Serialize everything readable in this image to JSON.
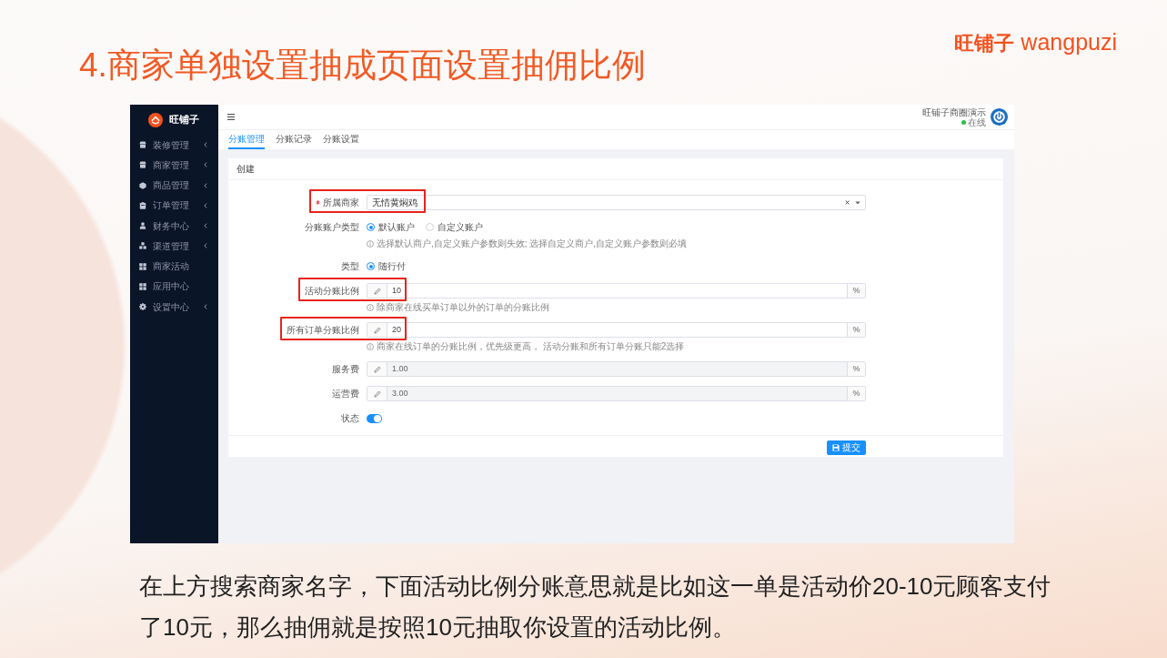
{
  "title": "4.商家单独设置抽成页面设置抽佣比例",
  "logo": {
    "cn": "旺铺子",
    "en": "wangpuzi"
  },
  "sidebar": {
    "brand": "旺铺子",
    "items": [
      {
        "label": "装修管理",
        "expandable": true
      },
      {
        "label": "商家管理",
        "expandable": true
      },
      {
        "label": "商品管理",
        "expandable": true
      },
      {
        "label": "订单管理",
        "expandable": true
      },
      {
        "label": "财务中心",
        "expandable": true
      },
      {
        "label": "渠道管理",
        "expandable": true
      },
      {
        "label": "商家活动",
        "expandable": false
      },
      {
        "label": "应用中心",
        "expandable": false
      },
      {
        "label": "设置中心",
        "expandable": true
      }
    ]
  },
  "topbar": {
    "user": "旺铺子商圈演示",
    "status": "在线",
    "online": true
  },
  "tabs": [
    {
      "label": "分账管理",
      "selected": true
    },
    {
      "label": "分账记录",
      "selected": false
    },
    {
      "label": "分账设置",
      "selected": false
    }
  ],
  "form": {
    "title": "创建",
    "fields": [
      {
        "kind": "select",
        "label": "所属商家",
        "required": true,
        "highlighted": true,
        "value": "无情黄焖鸡"
      },
      {
        "kind": "radio",
        "label": "分账账户类型",
        "required": false,
        "highlighted": false,
        "options": [
          {
            "label": "默认账户",
            "selected": true
          },
          {
            "label": "自定义账户",
            "selected": false
          }
        ],
        "help": "选择默认商户,自定义账户参数则失效; 选择自定义商户,自定义账户参数则必填"
      },
      {
        "kind": "radio",
        "label": "类型",
        "required": false,
        "highlighted": false,
        "options": [
          {
            "label": "随行付",
            "selected": true
          }
        ]
      },
      {
        "kind": "input",
        "label": "活动分账比例",
        "required": false,
        "highlighted": true,
        "value": "10",
        "unit": "%",
        "disabled": false,
        "help": "除商家在线买单订单以外的订单的分账比例"
      },
      {
        "kind": "input",
        "label": "所有订单分账比例",
        "required": false,
        "highlighted": true,
        "value": "20",
        "unit": "%",
        "disabled": false,
        "help": "商家在线订单的分账比例，优先级更高， 活动分账和所有订单分账只能2选择"
      },
      {
        "kind": "input",
        "label": "服务费",
        "required": false,
        "highlighted": false,
        "value": "1.00",
        "unit": "%",
        "disabled": true
      },
      {
        "kind": "input",
        "label": "运营费",
        "required": false,
        "highlighted": false,
        "value": "3.00",
        "unit": "%",
        "disabled": true
      },
      {
        "kind": "switch",
        "label": "状态",
        "required": false,
        "highlighted": false,
        "on": true
      }
    ],
    "submit": "提交"
  },
  "caption": "在上方搜索商家名字，下面活动比例分账意思就是比如这一单是活动价20-10元顾客支付了10元，那么抽佣就是按照10元抽取你设置的活动比例。"
}
